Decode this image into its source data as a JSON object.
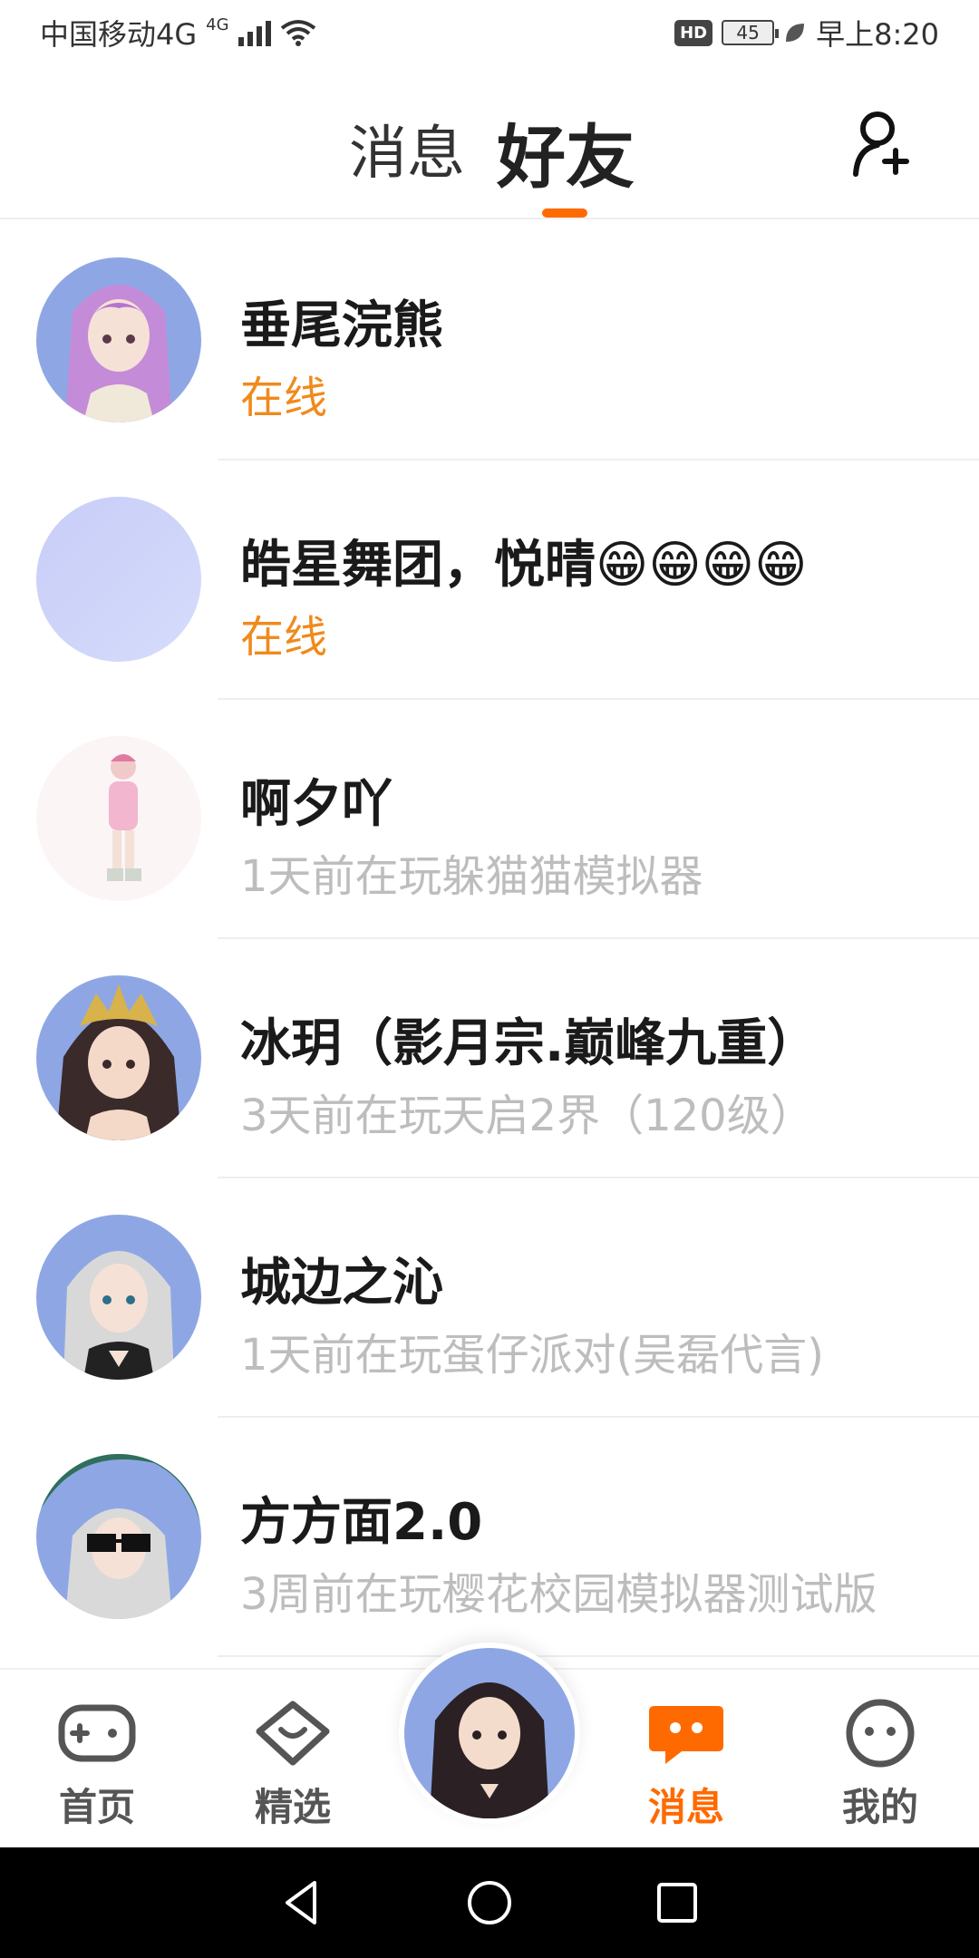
{
  "status_bar": {
    "carrier": "中国移动4G",
    "network_tag": "4G",
    "hd_badge": "HD",
    "battery_level": "45",
    "time": "早上8:20"
  },
  "header": {
    "tab_messages": "消息",
    "tab_friends": "好友",
    "active_tab": "好友",
    "add_friend_icon": "add-user-icon"
  },
  "friends": [
    {
      "name": "垂尾浣熊",
      "status": "在线",
      "online": true,
      "avatar": "purple-hair-girl"
    },
    {
      "name": "皓星舞团，悦晴😁😁😁😁",
      "status": "在线",
      "online": true,
      "avatar": "blank-lavender"
    },
    {
      "name": "啊夕吖",
      "status": "1天前在玩躲猫猫模拟器",
      "online": false,
      "avatar": "pink-outfit-girl"
    },
    {
      "name": "冰玥（影月宗.巅峰九重）",
      "status": "3天前在玩天启2界（120级）",
      "online": false,
      "avatar": "golden-crown-girl"
    },
    {
      "name": "城边之沁",
      "status": "1天前在玩蛋仔派对(吴磊代言)",
      "online": false,
      "avatar": "silver-hair-girl"
    },
    {
      "name": "方方面2.0",
      "status": "3周前在玩樱花校园模拟器测试版",
      "online": false,
      "avatar": "sunglasses-girl"
    }
  ],
  "bottom_nav": {
    "home": "首页",
    "featured": "精选",
    "messages": "消息",
    "me": "我的",
    "active": "消息"
  },
  "colors": {
    "accent": "#ff6a00",
    "online": "#f08a1c",
    "offline_text": "#bdbdbd"
  }
}
